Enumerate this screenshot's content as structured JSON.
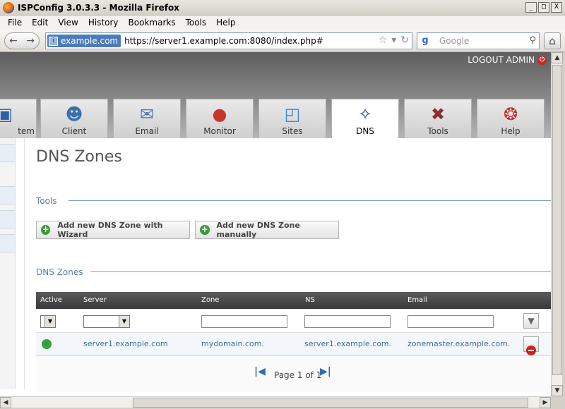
{
  "window": {
    "title": "ISPConfig 3.0.3.3 - Mozilla Firefox",
    "controls": [
      "_",
      "□",
      "X"
    ]
  },
  "menu": {
    "items": [
      {
        "label": "File"
      },
      {
        "label": "Edit"
      },
      {
        "label": "View"
      },
      {
        "label": "History"
      },
      {
        "label": "Bookmarks"
      },
      {
        "label": "Tools"
      },
      {
        "label": "Help"
      }
    ]
  },
  "nav": {
    "site_badge": "example.com",
    "url": "https://server1.example.com:8080/index.php#",
    "search_placeholder": "Google"
  },
  "header": {
    "logout_label": "LOGOUT ADMIN"
  },
  "tabs": [
    {
      "label": "tem",
      "icon": "monitor-screen-icon"
    },
    {
      "label": "Client",
      "icon": "users-icon"
    },
    {
      "label": "Email",
      "icon": "envelope-icon"
    },
    {
      "label": "Monitor",
      "icon": "traffic-light-icon"
    },
    {
      "label": "Sites",
      "icon": "globe-folder-icon"
    },
    {
      "label": "DNS",
      "icon": "network-nodes-icon",
      "active": true
    },
    {
      "label": "Tools",
      "icon": "wrench-screwdriver-icon"
    },
    {
      "label": "Help",
      "icon": "lifebuoy-icon"
    }
  ],
  "page": {
    "title": "DNS Zones",
    "tools_heading": "Tools",
    "zones_heading": "DNS Zones",
    "buttons": {
      "wizard": "Add new DNS Zone with Wizard",
      "manual": "Add new DNS Zone manually"
    }
  },
  "table": {
    "columns": [
      "Active",
      "Server",
      "Zone",
      "NS",
      "Email"
    ],
    "rows": [
      {
        "active": "yes",
        "server": "server1.example.com",
        "zone": "mydomain.com.",
        "ns": "server1.example.com.",
        "email": "zonemaster.example.com."
      }
    ],
    "pager": "Page 1 of 1"
  },
  "colors": {
    "accent_blue": "#3a6ea5",
    "heading_blue": "#5a7fa8",
    "header_dark": "#5e5e5e"
  }
}
